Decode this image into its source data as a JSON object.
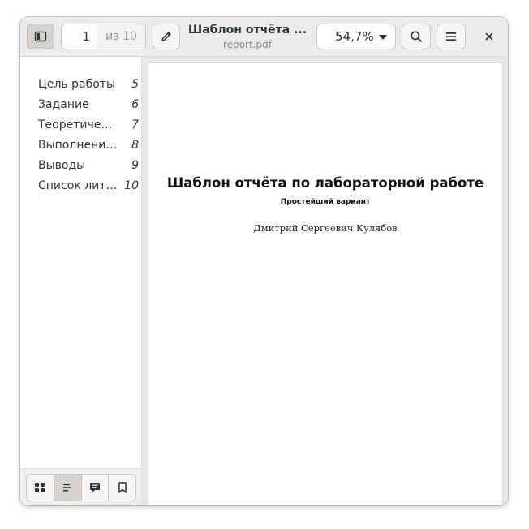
{
  "header": {
    "current_page": "1",
    "total_pages_label": "из 10",
    "title": "Шаблон отчёта ...",
    "filename": "report.pdf",
    "zoom": "54,7%"
  },
  "toc": [
    {
      "label": "Цель работы",
      "page": "5"
    },
    {
      "label": "Задание",
      "page": "6"
    },
    {
      "label": "Теоретичес…",
      "page": "7"
    },
    {
      "label": "Выполнение…",
      "page": "8"
    },
    {
      "label": "Выводы",
      "page": "9"
    },
    {
      "label": "Список лите…",
      "page": "10"
    }
  ],
  "sidebar_tabs": [
    {
      "icon": "grid-icon",
      "active": false
    },
    {
      "icon": "outline-icon",
      "active": true
    },
    {
      "icon": "annotations-icon",
      "active": false
    },
    {
      "icon": "bookmark-icon",
      "active": false
    }
  ],
  "document": {
    "title": "Шаблон отчёта по лабораторной работе",
    "subtitle": "Простейший вариант",
    "author": "Дмитрий Сергеевич Кулябов"
  },
  "colors": {
    "headerbar": "#ebebeb",
    "text": "#2e3436",
    "active_button": "#d6d3cf",
    "doc_background": "#e8e8e7"
  }
}
